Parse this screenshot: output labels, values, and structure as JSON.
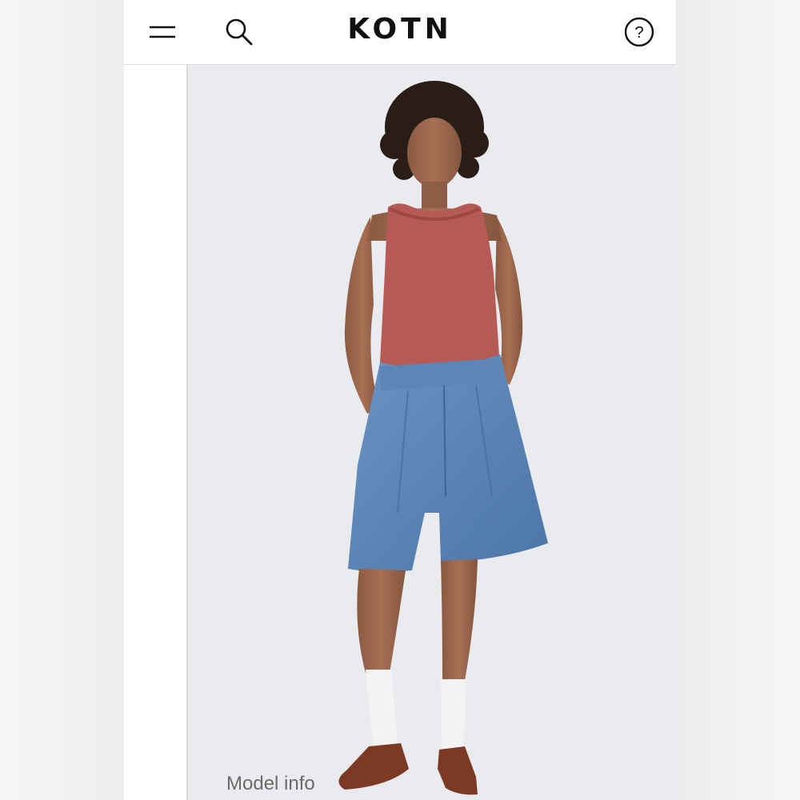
{
  "header": {
    "brand": "KOTN",
    "icons": {
      "menu": "menu-icon",
      "search": "search-icon",
      "help": "help-icon"
    }
  },
  "product_image": {
    "caption_link": "Model info",
    "description_colors": {
      "tank": "#b65a55",
      "shorts": "#5f87b7",
      "socks": "#f3f3f3",
      "loafers": "#7c3a24"
    }
  }
}
